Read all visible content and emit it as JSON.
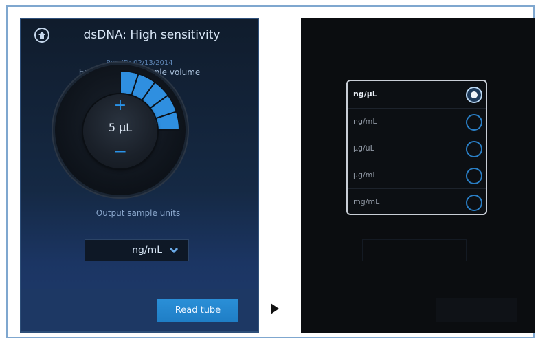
{
  "left_screen": {
    "title": "dsDNA: High sensitivity",
    "run_id": "Run ID: 02/13/2014",
    "prompt": "Enter original sample volume",
    "volume": "5 µL",
    "plus_symbol": "+",
    "minus_symbol": "−",
    "output_units_label": "Output sample units",
    "output_units_value": "ng/mL",
    "read_button": "Read tube",
    "icons": [
      "home-icon",
      "chevron-down-icon"
    ]
  },
  "right_screen": {
    "unit_options": [
      {
        "label": "ng/µL",
        "selected": true
      },
      {
        "label": "ng/mL",
        "selected": false
      },
      {
        "label": "µg/uL",
        "selected": false
      },
      {
        "label": "µg/mL",
        "selected": false
      },
      {
        "label": "mg/mL",
        "selected": false
      }
    ]
  },
  "colors": {
    "accent_blue": "#2a93e8",
    "dial_segment": "#2f8fe0",
    "button_blue": "#2a8fd7",
    "dark_background": "#0b0d10"
  },
  "dial": {
    "segments_total": 20,
    "segments_active": 5
  }
}
